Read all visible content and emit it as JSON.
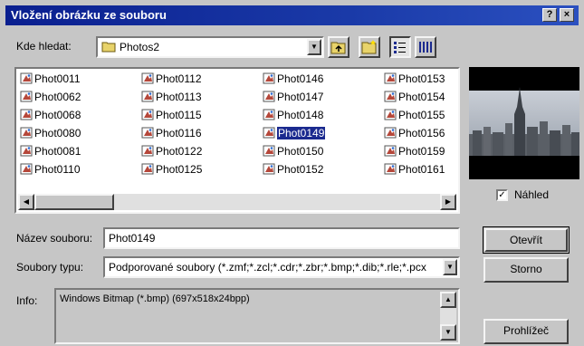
{
  "title": "Vložení obrázku ze souboru",
  "titlebar": {
    "help": "?",
    "close": "×"
  },
  "lookin": {
    "label": "Kde hledat:",
    "value": "Photos2"
  },
  "files": [
    [
      "Phot0011",
      "Phot0062",
      "Phot0068",
      "Phot0080",
      "Phot0081",
      "Phot0110"
    ],
    [
      "Phot0112",
      "Phot0113",
      "Phot0115",
      "Phot0116",
      "Phot0122",
      "Phot0125"
    ],
    [
      "Phot0146",
      "Phot0147",
      "Phot0148",
      "Phot0149",
      "Phot0150",
      "Phot0152"
    ],
    [
      "Phot0153",
      "Phot0154",
      "Phot0155",
      "Phot0156",
      "Phot0159",
      "Phot0161"
    ]
  ],
  "selected_file": "Phot0149",
  "preview": {
    "checkbox_label": "Náhled",
    "checked": true
  },
  "filename": {
    "label": "Název souboru:",
    "value": "Phot0149"
  },
  "filetype": {
    "label": "Soubory typu:",
    "value": "Podporované soubory (*.zmf;*.zcl;*.cdr;*.zbr;*.bmp;*.dib;*.rle;*.pcx"
  },
  "info": {
    "label": "Info:",
    "value": "Windows Bitmap (*.bmp) (697x518x24bpp)"
  },
  "buttons": {
    "open": "Otevřít",
    "cancel": "Storno",
    "browser": "Prohlížeč"
  }
}
